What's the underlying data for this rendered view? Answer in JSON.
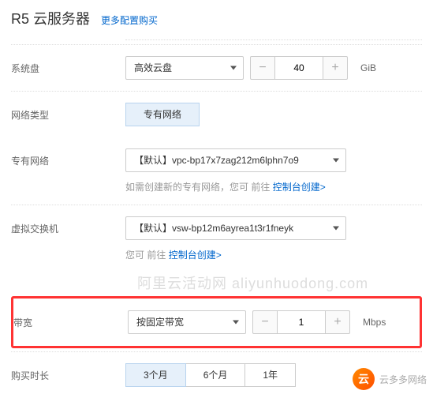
{
  "header": {
    "title": "R5 云服务器",
    "more_link": "更多配置购买"
  },
  "system_disk": {
    "label": "系统盘",
    "type_selected": "高效云盘",
    "size_value": "40",
    "unit": "GiB"
  },
  "network_type": {
    "label": "网络类型",
    "selected": "专有网络"
  },
  "vpc": {
    "label": "专有网络",
    "selected": "【默认】vpc-bp17x7zag212m6lphn7o9",
    "hint_prefix": "如需创建新的专有网络，您可 前往",
    "hint_link": "控制台创建>"
  },
  "vswitch": {
    "label": "虚拟交换机",
    "selected": "【默认】vsw-bp12m6ayrea1t3r1fneyk",
    "hint_prefix": "您可 前往",
    "hint_link": "控制台创建>"
  },
  "watermark_ghost": "阿里云活动网 aliyunhuodong.com",
  "bandwidth": {
    "label": "带宽",
    "mode_selected": "按固定带宽",
    "value": "1",
    "unit": "Mbps"
  },
  "duration": {
    "label": "购买时长",
    "options": [
      "3个月",
      "6个月",
      "1年"
    ],
    "active_index": 0
  },
  "watermark_corner": "云多多网络"
}
